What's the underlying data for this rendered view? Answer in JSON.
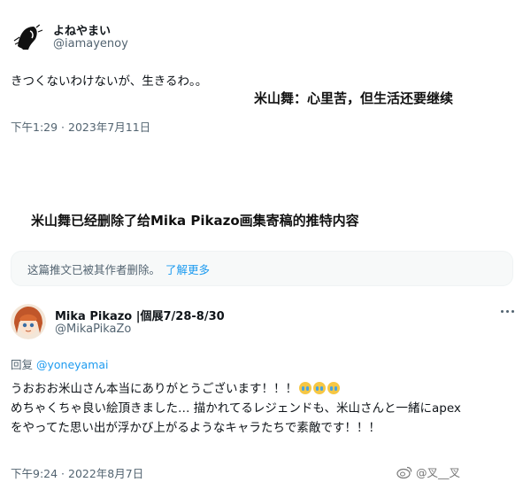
{
  "tweet1": {
    "display_name": "よねやまい",
    "handle": "@iamayenoy",
    "text": "きつくないわけないが、生きるわ。。",
    "timestamp": "下午1:29 · 2023年7月11日"
  },
  "caption_top": "米山舞：心里苦，但生活还要继续",
  "caption_middle": "米山舞已经删除了给Mika Pikazo画集寄稿的推特内容",
  "deleted_notice": {
    "text": "这篇推文已被其作者删除。",
    "link": "了解更多"
  },
  "tweet2": {
    "display_name": "Mika Pikazo |個展7/28-8/30",
    "handle": "@MikaPikaZo",
    "reply_prefix": "回复",
    "reply_to": "@yoneyamai",
    "line1": "うおおお米山さん本当にありがとうございます！！！",
    "line2": "めちゃくちゃ良い絵頂きました… 描かれてるレジェンドも、米山さんと一緒にapex",
    "line3": "をやってた思い出が浮かび上がるようなキャラたちで素敵です！！！",
    "timestamp": "下午9:24 · 2022年8月7日"
  },
  "watermark": "@叉__叉",
  "icons": {
    "avatar1": "ink-sketch-avatar",
    "avatar2": "anime-girl-avatar",
    "more": "more-dots-icon",
    "emoji": "loudly-crying-face",
    "watermark_logo": "weibo-logo-icon"
  },
  "colors": {
    "link": "#1d9bf0",
    "secondary_text": "#536471",
    "notice_bg": "#f7f9f9"
  }
}
